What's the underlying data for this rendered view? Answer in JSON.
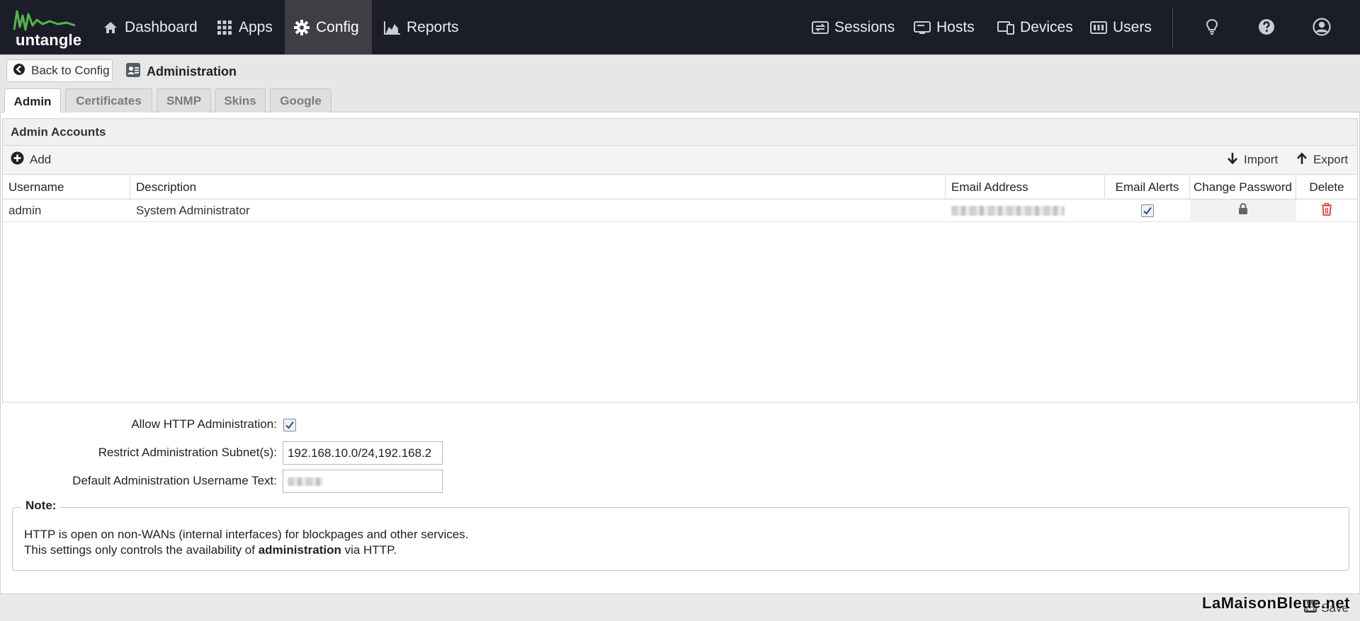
{
  "brand": {
    "logo_text": "untangle",
    "accent": "#55b54b"
  },
  "nav": {
    "left": [
      {
        "label": "Dashboard",
        "icon": "home-icon"
      },
      {
        "label": "Apps",
        "icon": "grid-icon"
      },
      {
        "label": "Config",
        "icon": "gear-icon",
        "active": true
      },
      {
        "label": "Reports",
        "icon": "area-chart-icon"
      }
    ],
    "right": [
      {
        "label": "Sessions",
        "icon": "sessions-icon"
      },
      {
        "label": "Hosts",
        "icon": "hosts-icon"
      },
      {
        "label": "Devices",
        "icon": "devices-icon"
      },
      {
        "label": "Users",
        "icon": "users-icon"
      }
    ]
  },
  "crumb": {
    "back_label": "Back to Config",
    "title": "Administration"
  },
  "tabs": [
    "Admin",
    "Certificates",
    "SNMP",
    "Skins",
    "Google"
  ],
  "panel": {
    "title": "Admin Accounts",
    "add_label": "Add",
    "import_label": "Import",
    "export_label": "Export"
  },
  "grid": {
    "columns": [
      "Username",
      "Description",
      "Email Address",
      "Email Alerts",
      "Change Password",
      "Delete"
    ],
    "rows": [
      {
        "username": "admin",
        "description": "System Administrator",
        "email_alerts": true
      }
    ]
  },
  "form": {
    "http_label": "Allow HTTP Administration:",
    "http_checked": true,
    "subnet_label": "Restrict Administration Subnet(s):",
    "subnet_value": "192.168.10.0/24,192.168.2",
    "username_text_label": "Default Administration Username Text:"
  },
  "note": {
    "title": "Note:",
    "line1": "HTTP is open on non-WANs (internal interfaces) for blockpages and other services.",
    "line2_pre": "This settings only controls the availability of ",
    "line2_bold": "administration",
    "line2_post": " via HTTP."
  },
  "footer": {
    "save_label": "Save",
    "watermark": "LaMaisonBleue.net"
  },
  "colors": {
    "nav_bg": "#1b1e28",
    "nav_active": "#3d3f45",
    "delete_red": "#e03b2e"
  }
}
